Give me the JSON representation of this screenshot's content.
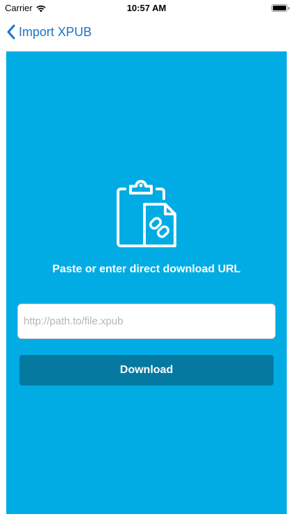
{
  "status_bar": {
    "carrier": "Carrier",
    "time": "10:57 AM",
    "icons": [
      "wifi-icon",
      "battery-icon"
    ]
  },
  "nav": {
    "back_label": "Import XPUB",
    "back_icon": "chevron-left-icon"
  },
  "main": {
    "hero_icon": "clipboard-link-icon",
    "prompt": "Paste or enter direct download URL",
    "url_input": {
      "value": "",
      "placeholder": "http://path.to/file.xpub"
    },
    "download_label": "Download"
  },
  "colors": {
    "accent": "#1a73c9",
    "panel": "#00ace3",
    "button": "#0579a0"
  }
}
